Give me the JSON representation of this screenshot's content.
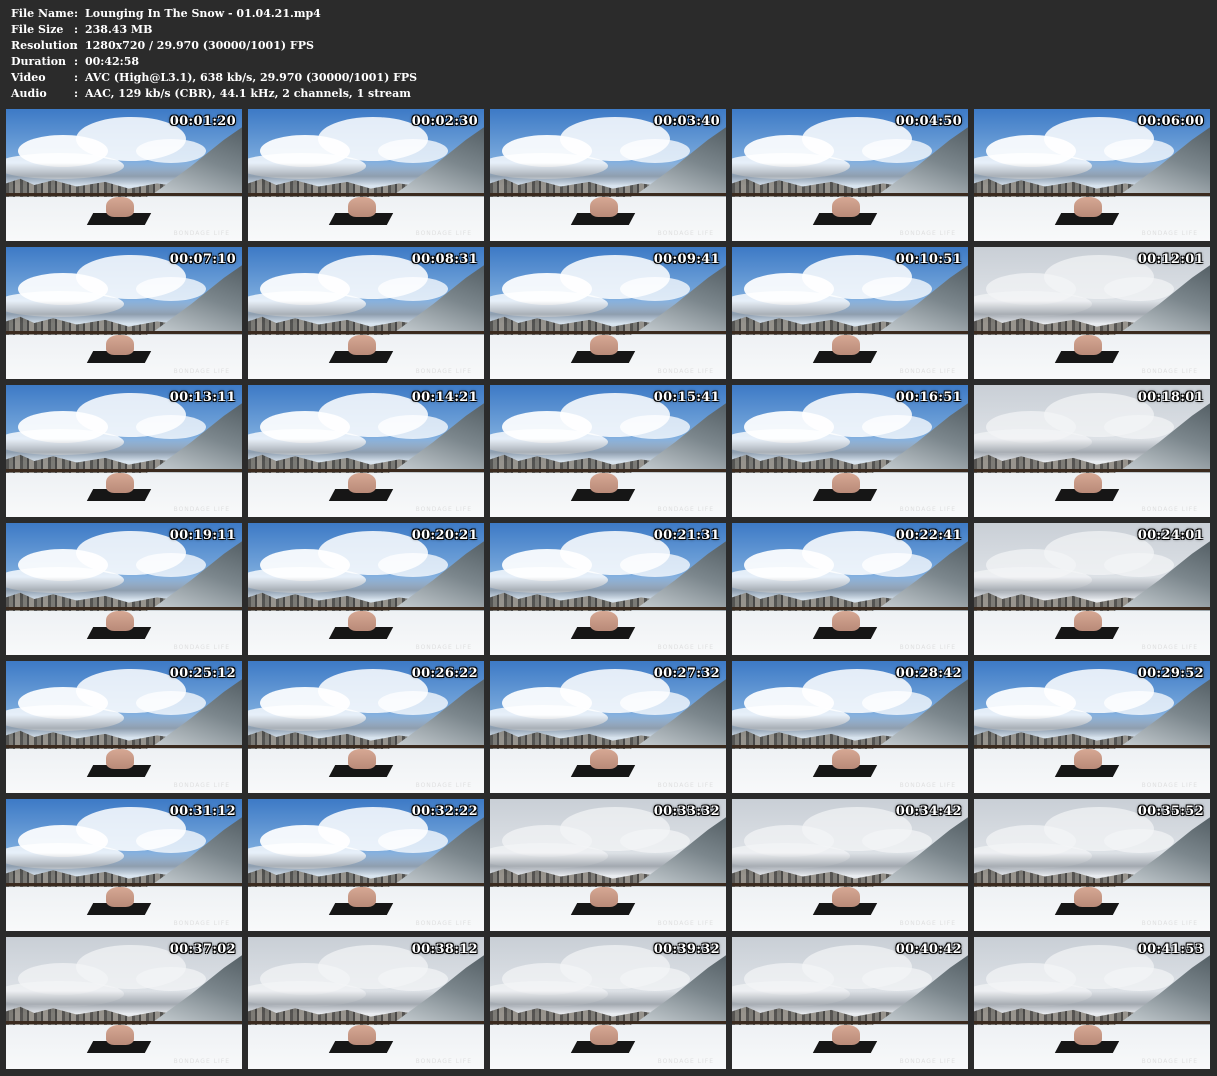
{
  "file_info": [
    {
      "label": "File Name",
      "value": "Lounging In The Snow - 01.04.21.mp4"
    },
    {
      "label": "File Size",
      "value": "238.43 MB"
    },
    {
      "label": "Resolution",
      "value": "1280x720 / 29.970 (30000/1001) FPS"
    },
    {
      "label": "Duration",
      "value": "00:42:58"
    },
    {
      "label": "Video",
      "value": "AVC (High@L3.1), 638 kb/s, 29.970 (30000/1001) FPS"
    },
    {
      "label": "Audio",
      "value": "AAC, 129 kb/s (CBR), 44.1 kHz, 2 channels, 1 stream"
    }
  ],
  "separator": ":",
  "watermark": "BONDAGE LIFE",
  "colors": {
    "background": "#2b2b2b",
    "text": "#ffffff"
  },
  "thumbnails": [
    {
      "timestamp": "00:01:20"
    },
    {
      "timestamp": "00:02:30"
    },
    {
      "timestamp": "00:03:40"
    },
    {
      "timestamp": "00:04:50"
    },
    {
      "timestamp": "00:06:00"
    },
    {
      "timestamp": "00:07:10"
    },
    {
      "timestamp": "00:08:31"
    },
    {
      "timestamp": "00:09:41"
    },
    {
      "timestamp": "00:10:51"
    },
    {
      "timestamp": "00:12:01"
    },
    {
      "timestamp": "00:13:11"
    },
    {
      "timestamp": "00:14:21"
    },
    {
      "timestamp": "00:15:41"
    },
    {
      "timestamp": "00:16:51"
    },
    {
      "timestamp": "00:18:01"
    },
    {
      "timestamp": "00:19:11"
    },
    {
      "timestamp": "00:20:21"
    },
    {
      "timestamp": "00:21:31"
    },
    {
      "timestamp": "00:22:41"
    },
    {
      "timestamp": "00:24:01"
    },
    {
      "timestamp": "00:25:12"
    },
    {
      "timestamp": "00:26:22"
    },
    {
      "timestamp": "00:27:32"
    },
    {
      "timestamp": "00:28:42"
    },
    {
      "timestamp": "00:29:52"
    },
    {
      "timestamp": "00:31:12"
    },
    {
      "timestamp": "00:32:22"
    },
    {
      "timestamp": "00:33:32"
    },
    {
      "timestamp": "00:34:42"
    },
    {
      "timestamp": "00:35:52"
    },
    {
      "timestamp": "00:37:02"
    },
    {
      "timestamp": "00:38:12"
    },
    {
      "timestamp": "00:39:32"
    },
    {
      "timestamp": "00:40:42"
    },
    {
      "timestamp": "00:41:53"
    }
  ]
}
